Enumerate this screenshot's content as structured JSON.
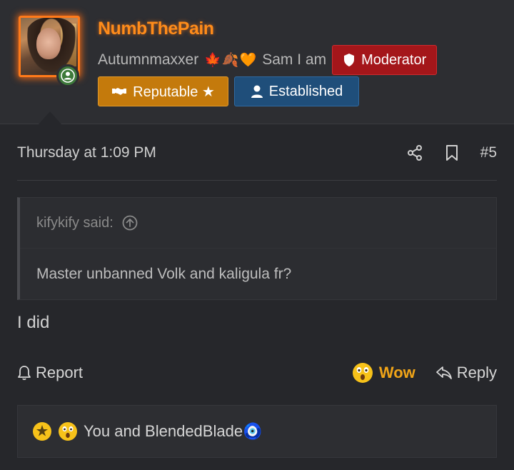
{
  "user": {
    "name": "NumbThePain",
    "title": "Autumnmaxxer",
    "title_emojis": [
      "🍁",
      "🍂",
      "🧡"
    ],
    "signature": "Sam I am",
    "badges": {
      "moderator": "Moderator",
      "reputable": "Reputable ★",
      "established": "Established"
    },
    "online": true
  },
  "post": {
    "date": "Thursday at 1:09 PM",
    "number": "#5",
    "quote": {
      "author_label": "kifykify said:",
      "text": "Master unbanned Volk and kaligula fr?"
    },
    "message": "I did"
  },
  "actions": {
    "report": "Report",
    "wow": "Wow",
    "reply": "Reply"
  },
  "reactions": {
    "summary": "You and BlendedBlade🧿"
  },
  "colors": {
    "accent": "#ff8c1a",
    "moderator": "#a4161a",
    "reputable": "#c47a0c",
    "established": "#1f4e7a",
    "wow": "#f0a418"
  }
}
